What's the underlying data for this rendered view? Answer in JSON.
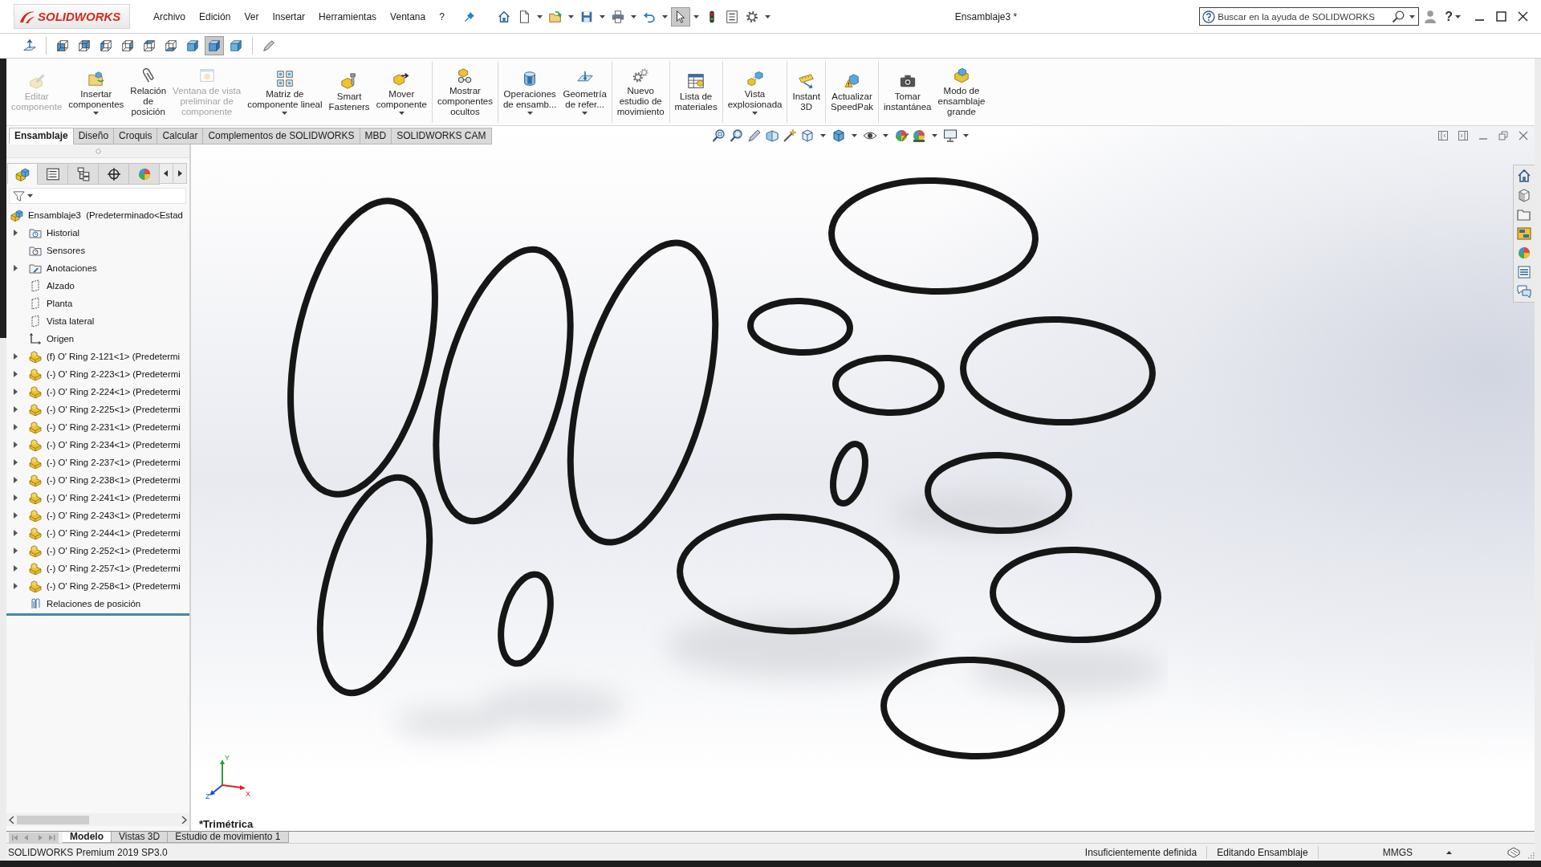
{
  "app": {
    "name": "SOLIDWORKS"
  },
  "menu": [
    "Archivo",
    "Edición",
    "Ver",
    "Insertar",
    "Herramientas",
    "Ventana",
    "?"
  ],
  "standard_toolbar": [
    {
      "kind": "home",
      "dropdown": false,
      "selected": false
    },
    {
      "kind": "new",
      "dropdown": true,
      "selected": false
    },
    {
      "kind": "open",
      "dropdown": true,
      "selected": false
    },
    {
      "kind": "save",
      "dropdown": true,
      "selected": false
    },
    {
      "kind": "print",
      "dropdown": true,
      "selected": false
    },
    {
      "kind": "undo",
      "dropdown": true,
      "selected": false
    },
    {
      "kind": "select",
      "dropdown": true,
      "selected": true
    },
    {
      "kind": "rebuild",
      "dropdown": false,
      "selected": false
    },
    {
      "kind": "file_properties",
      "dropdown": false,
      "selected": false
    },
    {
      "kind": "options",
      "dropdown": true,
      "selected": false
    }
  ],
  "window": {
    "title": "Ensamblaje3 *"
  },
  "search": {
    "placeholder": "Buscar en la ayuda de SOLIDWORKS"
  },
  "help_button": "?",
  "view_toolbar": [
    {
      "kind": "normal_to",
      "selected": false
    },
    {
      "kind": "front",
      "selected": false
    },
    {
      "kind": "back",
      "selected": false
    },
    {
      "kind": "left",
      "selected": false
    },
    {
      "kind": "right",
      "selected": false
    },
    {
      "kind": "top",
      "selected": false
    },
    {
      "kind": "bottom",
      "selected": false
    },
    {
      "kind": "isometric",
      "selected": false
    },
    {
      "kind": "trimetric",
      "selected": true
    },
    {
      "kind": "dimetric",
      "selected": false
    },
    {
      "kind": "view_selector",
      "selected": false
    }
  ],
  "ribbon": {
    "groups": [
      {
        "commands": [
          {
            "label": "Editar\ncomponente",
            "disabled": true,
            "dropdown": false
          },
          {
            "label": "Insertar\ncomponentes",
            "disabled": false,
            "dropdown": true
          },
          {
            "label": "Relación\nde\nposición",
            "disabled": false,
            "dropdown": false
          },
          {
            "label": "Ventana de vista\npreliminar de\ncomponente",
            "disabled": true,
            "dropdown": false
          },
          {
            "label": "Matriz de\ncomponente lineal",
            "disabled": false,
            "dropdown": true
          },
          {
            "label": "Smart\nFasteners",
            "disabled": false,
            "dropdown": false
          },
          {
            "label": "Mover\ncomponente",
            "disabled": false,
            "dropdown": true
          }
        ]
      },
      {
        "commands": [
          {
            "label": "Mostrar\ncomponentes\nocultos",
            "disabled": false,
            "dropdown": false
          }
        ]
      },
      {
        "commands": [
          {
            "label": "Operaciones\nde ensamb...",
            "disabled": false,
            "dropdown": true
          },
          {
            "label": "Geometría\nde refer...",
            "disabled": false,
            "dropdown": true
          }
        ]
      },
      {
        "commands": [
          {
            "label": "Nuevo\nestudio de\nmovimiento",
            "disabled": false,
            "dropdown": false
          }
        ]
      },
      {
        "commands": [
          {
            "label": "Lista de\nmateriales",
            "disabled": false,
            "dropdown": false
          }
        ]
      },
      {
        "commands": [
          {
            "label": "Vista\nexplosionada",
            "disabled": false,
            "dropdown": true
          }
        ]
      },
      {
        "commands": [
          {
            "label": "Instant\n3D",
            "disabled": false,
            "dropdown": false
          }
        ]
      },
      {
        "commands": [
          {
            "label": "Actualizar\nSpeedPak",
            "disabled": false,
            "dropdown": false
          }
        ]
      },
      {
        "commands": [
          {
            "label": "Tomar\ninstantánea",
            "disabled": false,
            "dropdown": false
          },
          {
            "label": "Modo de\nensamblaje\ngrande",
            "disabled": false,
            "dropdown": false
          }
        ]
      }
    ]
  },
  "command_tabs": [
    {
      "label": "Ensamblaje",
      "selected": true
    },
    {
      "label": "Diseño",
      "selected": false
    },
    {
      "label": "Croquis",
      "selected": false
    },
    {
      "label": "Calcular",
      "selected": false
    },
    {
      "label": "Complementos de SOLIDWORKS",
      "selected": false
    },
    {
      "label": "MBD",
      "selected": false
    },
    {
      "label": "SOLIDWORKS CAM",
      "selected": false
    }
  ],
  "feature_manager": {
    "tabs": [
      {
        "kind": "feature_manager",
        "selected": true
      },
      {
        "kind": "property_manager",
        "selected": false
      },
      {
        "kind": "configuration_manager",
        "selected": false
      },
      {
        "kind": "dimxpert",
        "selected": false
      },
      {
        "kind": "display_manager",
        "selected": false
      }
    ],
    "tree": {
      "label": "Ensamblaje3  (Predeterminado<Estad",
      "kind": "assembly",
      "collapsed": false,
      "children": [
        {
          "label": "Historial",
          "kind": "history",
          "collapsed": true
        },
        {
          "label": "Sensores",
          "kind": "sensors",
          "collapsed": false
        },
        {
          "label": "Anotaciones",
          "kind": "annotations",
          "collapsed": true
        },
        {
          "label": "Alzado",
          "kind": "plane",
          "collapsed": false
        },
        {
          "label": "Planta",
          "kind": "plane",
          "collapsed": false
        },
        {
          "label": "Vista lateral",
          "kind": "plane",
          "collapsed": false
        },
        {
          "label": "Origen",
          "kind": "origin",
          "collapsed": false
        },
        {
          "label": "(f) O' Ring 2-121<1> (Predetermi",
          "kind": "part",
          "collapsed": true
        },
        {
          "label": "(-) O' Ring 2-223<1> (Predetermi",
          "kind": "part",
          "collapsed": true
        },
        {
          "label": "(-) O' Ring 2-224<1> (Predetermi",
          "kind": "part",
          "collapsed": true
        },
        {
          "label": "(-) O' Ring 2-225<1> (Predetermi",
          "kind": "part",
          "collapsed": true
        },
        {
          "label": "(-) O' Ring 2-231<1> (Predetermi",
          "kind": "part",
          "collapsed": true
        },
        {
          "label": "(-) O' Ring 2-234<1> (Predetermi",
          "kind": "part",
          "collapsed": true
        },
        {
          "label": "(-) O' Ring 2-237<1> (Predetermi",
          "kind": "part",
          "collapsed": true
        },
        {
          "label": "(-) O' Ring 2-238<1> (Predetermi",
          "kind": "part",
          "collapsed": true
        },
        {
          "label": "(-) O' Ring 2-241<1> (Predetermi",
          "kind": "part",
          "collapsed": true
        },
        {
          "label": "(-) O' Ring 2-243<1> (Predetermi",
          "kind": "part",
          "collapsed": true
        },
        {
          "label": "(-) O' Ring 2-244<1> (Predetermi",
          "kind": "part",
          "collapsed": true
        },
        {
          "label": "(-) O' Ring 2-252<1> (Predetermi",
          "kind": "part",
          "collapsed": true
        },
        {
          "label": "(-) O' Ring 2-257<1> (Predetermi",
          "kind": "part",
          "collapsed": true
        },
        {
          "label": "(-) O' Ring 2-258<1> (Predetermi",
          "kind": "part",
          "collapsed": true
        },
        {
          "label": "Relaciones de posición",
          "kind": "mates",
          "collapsed": false
        }
      ]
    }
  },
  "viewport": {
    "view_name": "*Trimétrica",
    "triad_axes": [
      "X",
      "Y",
      "Z"
    ]
  },
  "bottom_tabs": [
    {
      "label": "Modelo",
      "selected": true
    },
    {
      "label": "Vistas 3D",
      "selected": false
    },
    {
      "label": "Estudio de movimiento 1",
      "selected": false
    }
  ],
  "status_bar": {
    "product": "SOLIDWORKS Premium 2019 SP3.0",
    "definition": "Insuficientemente definida",
    "mode": "Editando Ensamblaje",
    "units": "MMGS"
  }
}
